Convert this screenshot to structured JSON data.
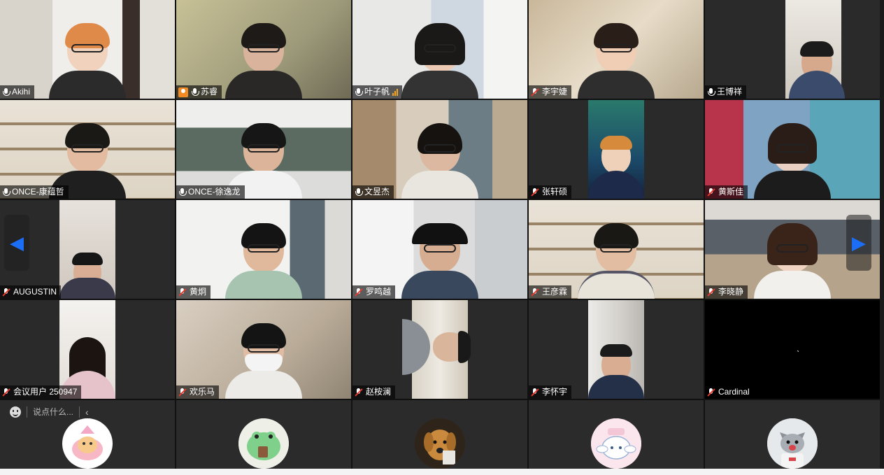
{
  "participants": [
    {
      "name": "Akihi",
      "mic": "on"
    },
    {
      "name": "苏睿",
      "mic": "on",
      "host": true
    },
    {
      "name": "叶子帆",
      "mic": "on",
      "signal": true
    },
    {
      "name": "李宇婕",
      "mic": "muted"
    },
    {
      "name": "王博祥",
      "mic": "on"
    },
    {
      "name": "ONCE-康蕴哲",
      "mic": "on"
    },
    {
      "name": "ONCE-徐逸龙",
      "mic": "on"
    },
    {
      "name": "文昱杰",
      "mic": "on"
    },
    {
      "name": "张轩硕",
      "mic": "muted"
    },
    {
      "name": "黄斯佳",
      "mic": "muted"
    },
    {
      "name": "AUGUSTIN",
      "mic": "muted"
    },
    {
      "name": "黄炯",
      "mic": "muted"
    },
    {
      "name": "罗鸣越",
      "mic": "muted"
    },
    {
      "name": "王彦霖",
      "mic": "muted"
    },
    {
      "name": "李晓静",
      "mic": "muted"
    },
    {
      "name": "会议用户 250947",
      "mic": "muted"
    },
    {
      "name": "欢乐马",
      "mic": "muted"
    },
    {
      "name": "赵桉澜",
      "mic": "muted"
    },
    {
      "name": "李怀宇",
      "mic": "muted"
    },
    {
      "name": "Cardinal",
      "mic": "muted"
    }
  ],
  "chat": {
    "placeholder": "说点什么...",
    "collapse_glyph": "‹"
  },
  "nav": {
    "prev_glyph": "◀",
    "next_glyph": "▶"
  },
  "tile20_mark": "ˎ",
  "avatars": [
    "pink-bear-avatar",
    "green-frog-avatar",
    "golden-dog-avatar",
    "cinnamoroll-avatar",
    "cat-avatar"
  ],
  "colors": {
    "active_speaker": "#23c25a",
    "nav_arrow": "#1b6ef5",
    "muted": "#e5382e"
  }
}
